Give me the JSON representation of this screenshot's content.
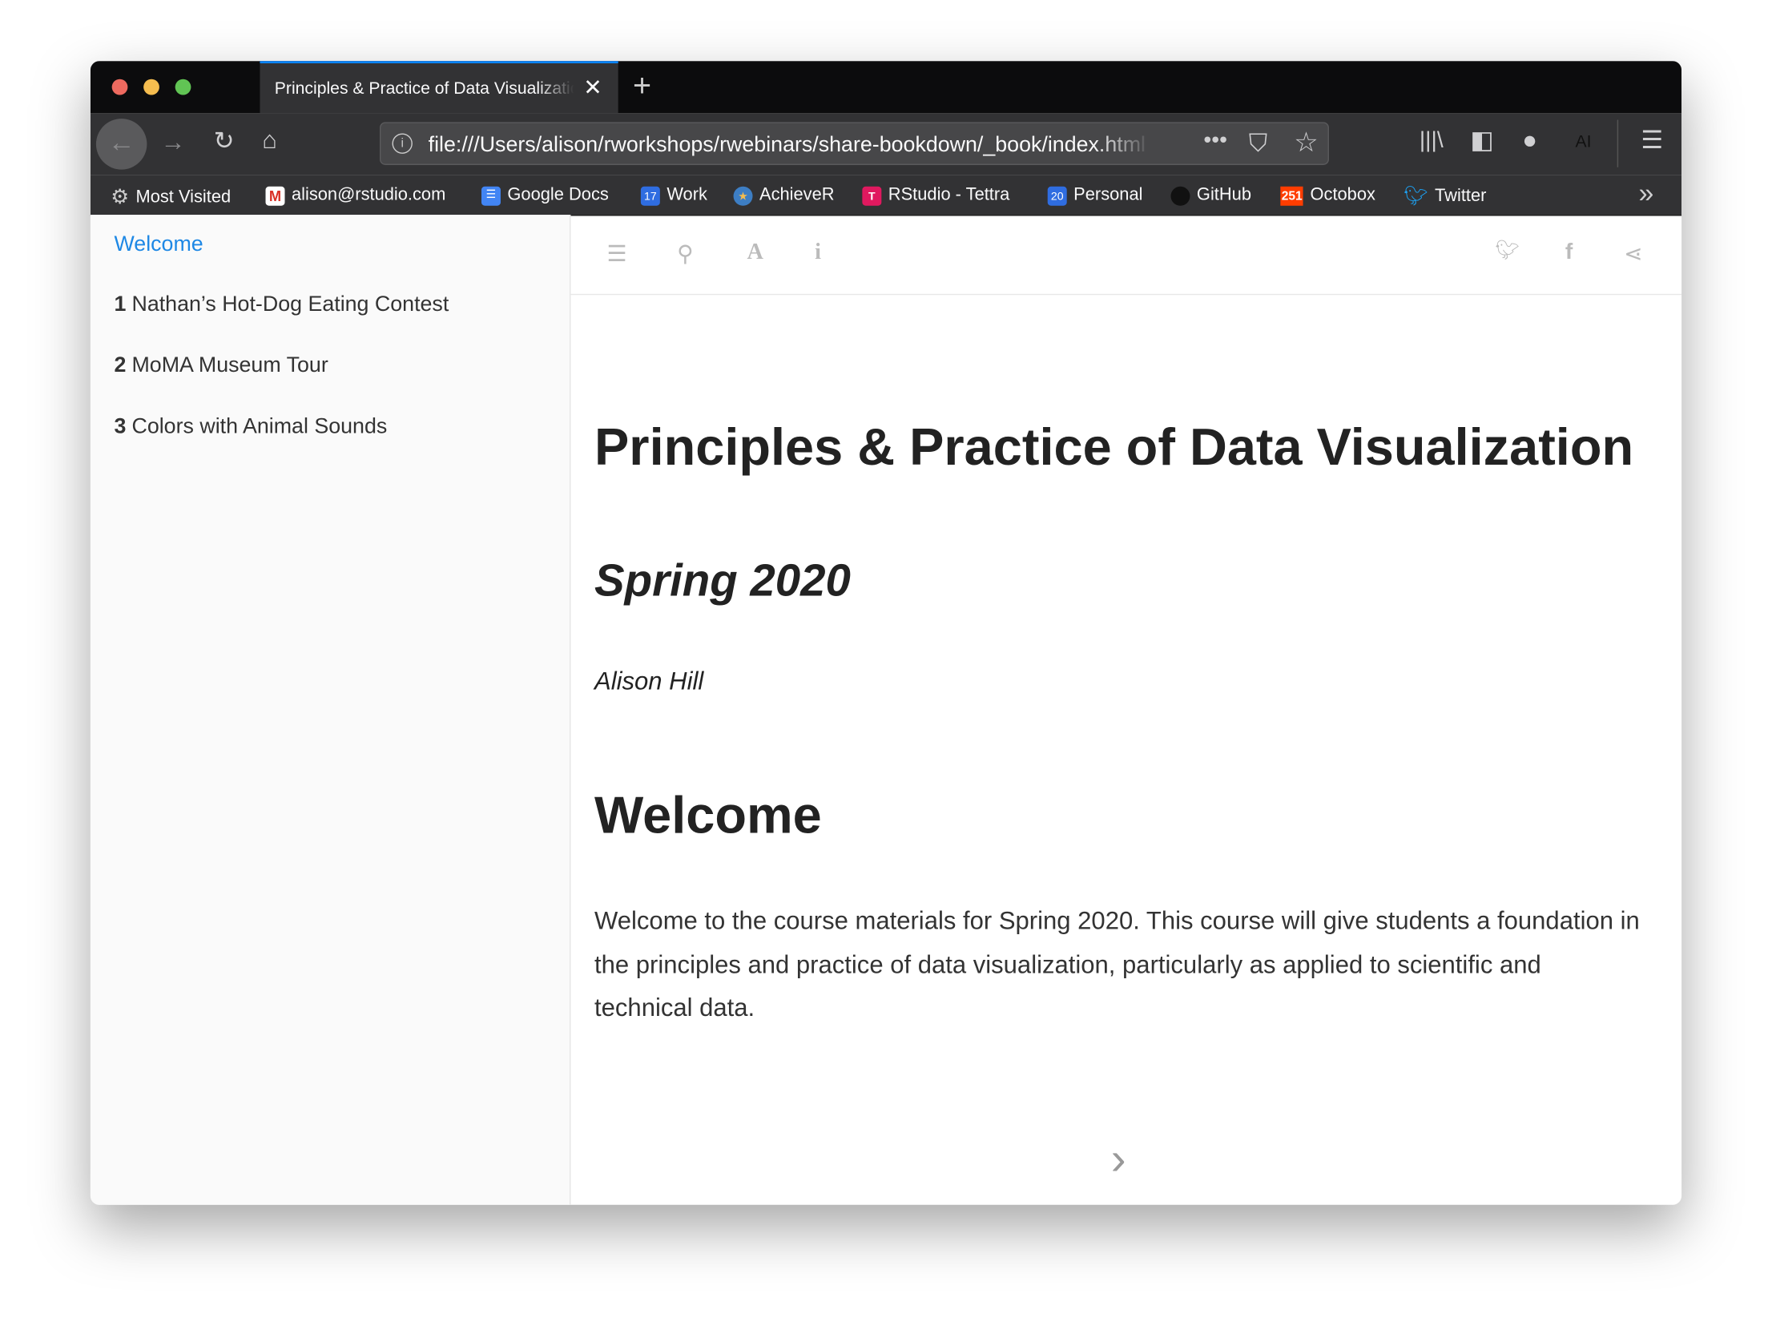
{
  "browser": {
    "tab_title": "Principles & Practice of Data Visualization",
    "url": "file:///Users/alison/rworkshops/rwebinars/share-bookdown/_book/index.html",
    "accent": "#0a84ff",
    "toolbar_icons": [
      "back-icon",
      "forward-icon",
      "reload-icon",
      "home-icon",
      "info-icon",
      "more-icon",
      "pocket-icon",
      "star-icon",
      "library-icon",
      "sidebar-icon",
      "account-icon",
      "extension-ai-icon",
      "menu-icon"
    ],
    "extension_label": "AI",
    "bookmarks": [
      {
        "label": "Most Visited",
        "icon": "gear-icon"
      },
      {
        "label": "alison@rstudio.com",
        "icon": "gmail-icon"
      },
      {
        "label": "Google Docs",
        "icon": "google-docs-icon"
      },
      {
        "label": "Work",
        "icon": "calendar-icon",
        "badge": "17"
      },
      {
        "label": "AchieveR",
        "icon": "achiever-icon"
      },
      {
        "label": "RStudio - Tettra",
        "icon": "tettra-icon"
      },
      {
        "label": "Personal",
        "icon": "calendar-icon",
        "badge": "20"
      },
      {
        "label": "GitHub",
        "icon": "github-icon"
      },
      {
        "label": "Octobox",
        "icon": "octobox-icon",
        "badge": "251"
      },
      {
        "label": "Twitter",
        "icon": "twitter-icon"
      }
    ]
  },
  "sidebar": {
    "active_color": "#1e88e5",
    "items": [
      {
        "num": "",
        "label": "Welcome"
      },
      {
        "num": "1",
        "label": "Nathan’s Hot-Dog Eating Contest"
      },
      {
        "num": "2",
        "label": "MoMA Museum Tour"
      },
      {
        "num": "3",
        "label": "Colors with Animal Sounds"
      }
    ]
  },
  "book_toolbar": {
    "icons": [
      "toc-toggle-icon",
      "search-icon",
      "font-settings-icon",
      "info-icon",
      "twitter-icon",
      "facebook-icon",
      "share-icon"
    ]
  },
  "content": {
    "title": "Principles & Practice of Data Visualization",
    "subtitle": "Spring 2020",
    "author": "Alison Hill",
    "section_heading": "Welcome",
    "paragraph": "Welcome to the course materials for Spring 2020. This course will give students a foundation in the principles and practice of data visualization, particularly as applied to scientific and technical data."
  }
}
